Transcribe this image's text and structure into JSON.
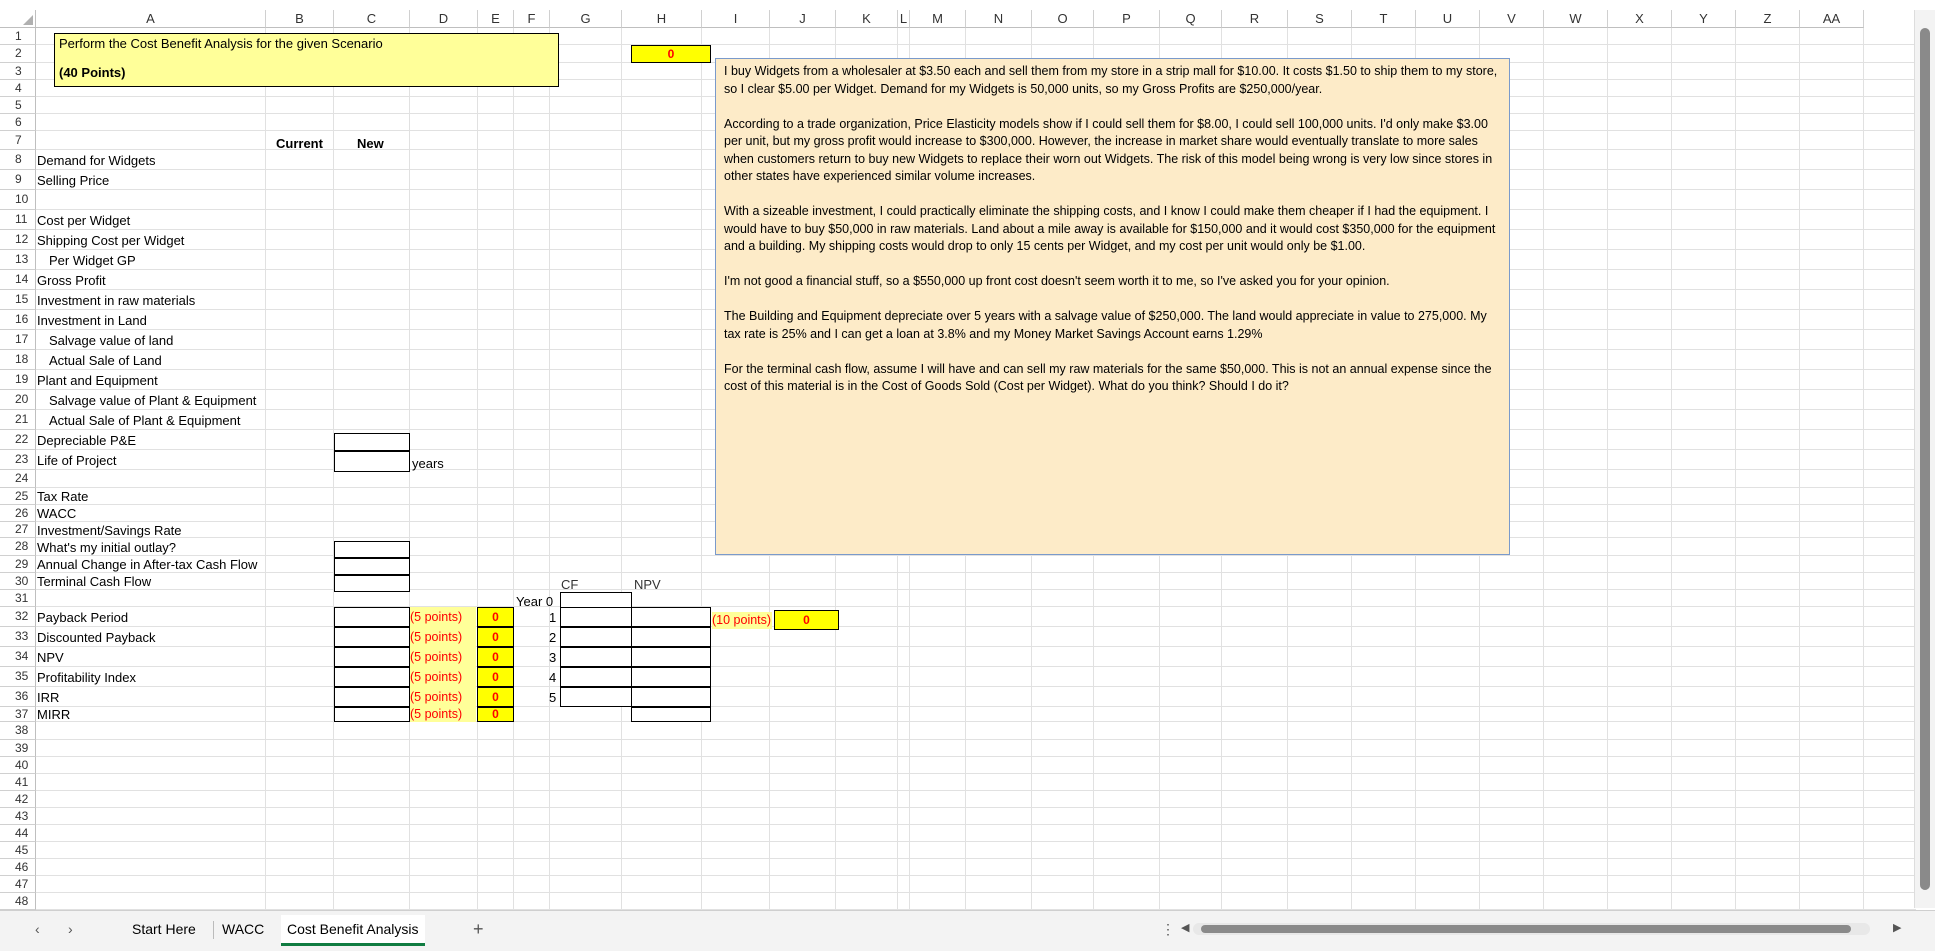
{
  "columns": [
    "A",
    "B",
    "C",
    "D",
    "E",
    "F",
    "G",
    "H",
    "I",
    "J",
    "K",
    "L",
    "M",
    "N",
    "O",
    "P",
    "Q",
    "R",
    "S",
    "T",
    "U",
    "V",
    "W",
    "X",
    "Y",
    "Z",
    "AA"
  ],
  "rows": [
    "1",
    "2",
    "3",
    "4",
    "5",
    "6",
    "7",
    "8",
    "9",
    "10",
    "11",
    "12",
    "13",
    "14",
    "15",
    "16",
    "17",
    "18",
    "19",
    "20",
    "21",
    "22",
    "23",
    "24",
    "25",
    "26",
    "27",
    "28",
    "29",
    "30",
    "31",
    "32",
    "33",
    "34",
    "35",
    "36",
    "37",
    "38",
    "39",
    "40",
    "41",
    "42",
    "43",
    "44",
    "45",
    "46",
    "47",
    "48"
  ],
  "title": {
    "line1": "Perform the Cost Benefit Analysis for the given Scenario",
    "line2": "(40 Points)"
  },
  "h2_value": "0",
  "headers": {
    "current": "Current",
    "new": "New"
  },
  "labels": {
    "r8": "Demand for Widgets",
    "r9": "Selling Price",
    "r11": "Cost per Widget",
    "r12": "Shipping Cost per Widget",
    "r13": "Per Widget GP",
    "r14": "Gross Profit",
    "r15": "Investment in raw materials",
    "r16": "Investment in Land",
    "r17": "Salvage value of land",
    "r18": "Actual Sale of Land",
    "r19": "Plant and Equipment",
    "r20": "Salvage value of Plant & Equipment",
    "r21": "Actual Sale of Plant & Equipment",
    "r22": "Depreciable P&E",
    "r23": "Life of Project",
    "r25": "Tax Rate",
    "r26": "WACC",
    "r27": "Investment/Savings Rate",
    "r28": "What's my initial outlay?",
    "r29": "Annual Change in After-tax Cash Flow",
    "r30": "Terminal Cash Flow",
    "r32": "Payback Period",
    "r33": "Discounted Payback",
    "r34": "NPV",
    "r35": "Profitability Index",
    "r36": "IRR",
    "r37": "MIRR"
  },
  "years_label": "years",
  "cf_header": "CF",
  "npv_header": "NPV",
  "year0_label": "Year 0",
  "year_numbers": [
    "1",
    "2",
    "3",
    "4",
    "5"
  ],
  "points_label": "(5 points)",
  "points_value": "0",
  "cf_points_label": "(10 points)",
  "cf_points_value": "0",
  "scenario": {
    "p1": "I buy Widgets from a wholesaler at $3.50 each and sell them from my store in a strip mall for $10.00.  It costs $1.50 to ship them to my store, so I clear $5.00 per Widget.  Demand for my Widgets is 50,000 units, so my Gross Profits are $250,000/year.",
    "p2": "According to a trade organization, Price Elasticity models show if I could sell them for $8.00, I could sell 100,000 units.  I'd only make $3.00 per unit, but my gross profit would increase to $300,000.  However, the increase in market share would eventually translate to more sales when customers return to buy new Widgets to replace their worn out Widgets.  The risk of this model being wrong is very low since stores in other states have experienced similar volume increases.",
    "p3": "With a sizeable investment, I could practically eliminate the shipping costs, and I know I could make them cheaper if I had the equipment.  I would have to buy $50,000 in raw materials.  Land about a mile away is available for $150,000 and it would cost $350,000 for the equipment and a building.  My shipping costs would drop to only 15 cents per Widget, and my cost per unit would only be $1.00.",
    "p4": "I'm not good a financial stuff, so a $550,000 up front cost doesn't seem worth it to me, so I've asked you for your opinion.",
    "p5": "The Building and Equipment depreciate over 5 years with a salvage value of $250,000.  The land would appreciate in value to 275,000.  My tax rate is 25% and I can get a loan at 3.8% and my Money Market Savings Account earns 1.29%",
    "p6": "For the terminal cash flow, assume I will have and can sell my raw materials for the same $50,000.  This is not an annual expense since the cost of this material is in the Cost of Goods Sold (Cost per Widget).  What do you think?  Should I do it?"
  },
  "tabs": [
    "Start Here",
    "WACC",
    "Cost Benefit Analysis"
  ],
  "active_tab": "Cost Benefit Analysis",
  "add_sheet": "+",
  "more_menu": "⋮"
}
